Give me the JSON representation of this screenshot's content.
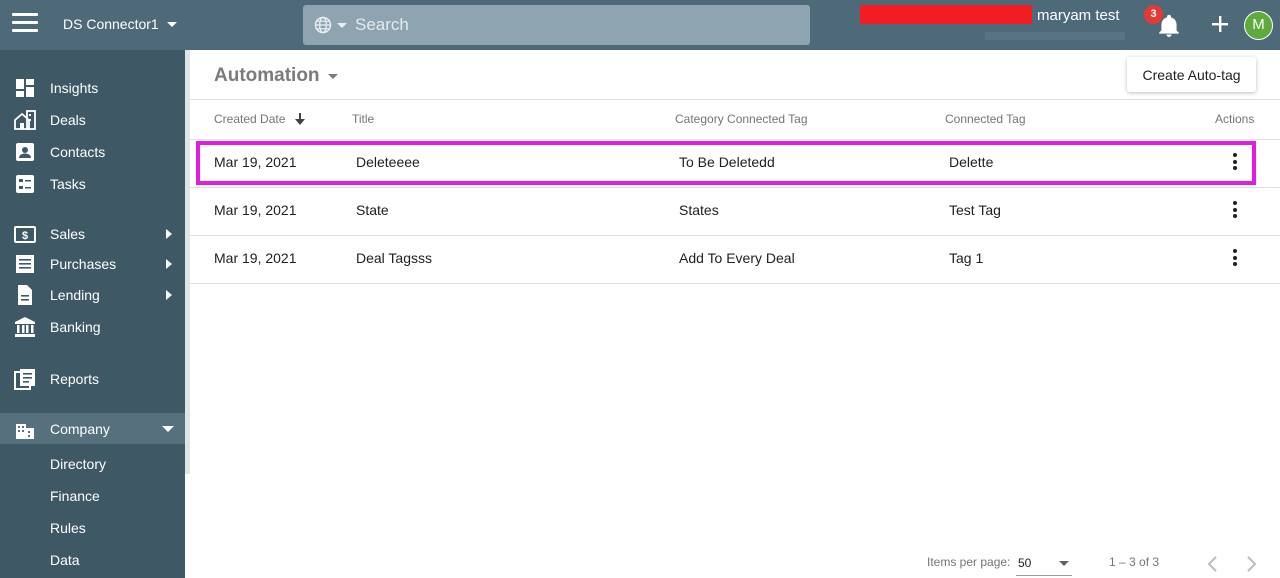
{
  "topbar": {
    "workspace": "DS Connector1",
    "search_placeholder": "Search",
    "user_name": "maryam test",
    "notification_count": "3",
    "avatar_initial": "M",
    "colors": {
      "bar": "#4e6a79",
      "search": "#8ea4b0",
      "badge": "#e53935",
      "avatar": "#5eaa3c"
    }
  },
  "sidebar": {
    "items": [
      {
        "label": "Insights",
        "icon": "dashboard-icon"
      },
      {
        "label": "Deals",
        "icon": "deals-icon"
      },
      {
        "label": "Contacts",
        "icon": "contacts-icon"
      },
      {
        "label": "Tasks",
        "icon": "tasks-icon"
      },
      {
        "label": "Sales",
        "icon": "dollar-icon"
      },
      {
        "label": "Purchases",
        "icon": "list-icon"
      },
      {
        "label": "Lending",
        "icon": "document-icon"
      },
      {
        "label": "Banking",
        "icon": "bank-icon"
      },
      {
        "label": "Reports",
        "icon": "reports-icon"
      },
      {
        "label": "Company",
        "icon": "building-icon"
      }
    ],
    "company_sub": [
      "Directory",
      "Finance",
      "Rules",
      "Data"
    ]
  },
  "main": {
    "title": "Automation",
    "create_button": "Create Auto-tag",
    "columns": [
      "Created Date",
      "Title",
      "Category Connected Tag",
      "Connected Tag",
      "Actions"
    ],
    "rows": [
      {
        "date": "Mar 19, 2021",
        "title": "Deleteeee",
        "category_tag": "To Be Deletedd",
        "tag": "Delette"
      },
      {
        "date": "Mar 19, 2021",
        "title": "State",
        "category_tag": "States",
        "tag": "Test Tag"
      },
      {
        "date": "Mar 19, 2021",
        "title": "Deal Tagsss",
        "category_tag": "Add To Every Deal",
        "tag": "Tag 1"
      }
    ],
    "pagination": {
      "items_per_page_label": "Items per page:",
      "items_per_page": "50",
      "range": "1 – 3 of 3"
    }
  }
}
